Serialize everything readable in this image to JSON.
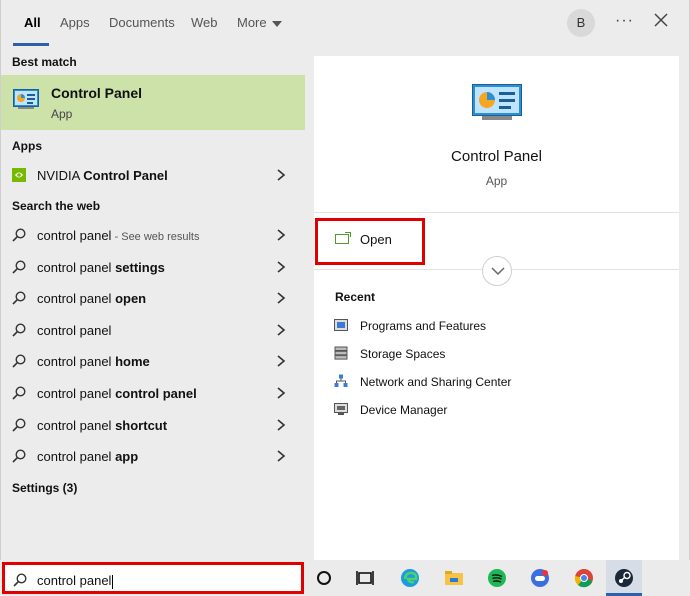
{
  "tabs": [
    "All",
    "Apps",
    "Documents",
    "Web",
    "More"
  ],
  "header": {
    "avatar_initial": "B",
    "more_options": "···"
  },
  "left": {
    "best_match_heading": "Best match",
    "best_match": {
      "title": "Control Panel",
      "subtitle": "App"
    },
    "apps_heading": "Apps",
    "apps": [
      {
        "pre": "NVIDIA ",
        "bold": "Control Panel"
      }
    ],
    "web_heading": "Search the web",
    "web_results": [
      {
        "pre": "control panel",
        "bold": "",
        "sub": " - See web results"
      },
      {
        "pre": "control panel ",
        "bold": "settings",
        "sub": ""
      },
      {
        "pre": "control panel ",
        "bold": "open",
        "sub": ""
      },
      {
        "pre": "control panel",
        "bold": "",
        "sub": ""
      },
      {
        "pre": "control panel ",
        "bold": "home",
        "sub": ""
      },
      {
        "pre": "control panel ",
        "bold": "control panel",
        "sub": ""
      },
      {
        "pre": "control panel ",
        "bold": "shortcut",
        "sub": ""
      },
      {
        "pre": "control panel ",
        "bold": "app",
        "sub": ""
      }
    ],
    "settings_heading": "Settings (3)"
  },
  "right": {
    "title": "Control Panel",
    "subtitle": "App",
    "open_label": "Open",
    "recent_heading": "Recent",
    "recent": [
      {
        "label": "Programs and Features",
        "icon": "programs-features-icon"
      },
      {
        "label": "Storage Spaces",
        "icon": "storage-spaces-icon"
      },
      {
        "label": "Network and Sharing Center",
        "icon": "network-center-icon"
      },
      {
        "label": "Device Manager",
        "icon": "device-manager-icon"
      }
    ]
  },
  "search": {
    "value": "control panel"
  },
  "taskbar": {
    "icons": [
      "cortana-icon",
      "task-view-icon",
      "edge-icon",
      "file-explorer-icon",
      "spotify-icon",
      "game-app-icon",
      "chrome-icon",
      "steam-icon"
    ]
  },
  "colors": {
    "accent": "#2f5fa8",
    "best_match_bg": "#cde2a8",
    "highlight": "#e00000"
  }
}
